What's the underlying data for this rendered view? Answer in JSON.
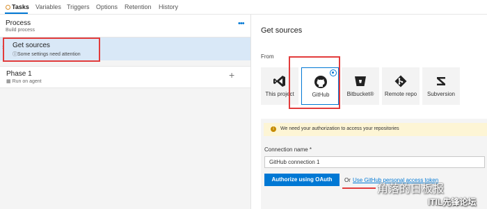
{
  "tabs": [
    {
      "label": "Tasks",
      "active": true
    },
    {
      "label": "Variables"
    },
    {
      "label": "Triggers"
    },
    {
      "label": "Options"
    },
    {
      "label": "Retention"
    },
    {
      "label": "History"
    }
  ],
  "process": {
    "title": "Process",
    "subtitle": "Build process",
    "more": "•••"
  },
  "get_sources_item": {
    "title": "Get sources",
    "warning": "Some settings need attention"
  },
  "phase": {
    "title": "Phase 1",
    "subtitle": "Run on agent",
    "add": "+"
  },
  "right_panel": {
    "title": "Get sources",
    "from_label": "From",
    "sources": [
      {
        "label": "This project",
        "icon": "visual-studio-icon"
      },
      {
        "label": "GitHub",
        "icon": "github-icon",
        "selected": true
      },
      {
        "label": "Bitbucket®",
        "icon": "bitbucket-icon"
      },
      {
        "label": "Remote repo",
        "icon": "git-icon"
      },
      {
        "label": "Subversion",
        "icon": "subversion-icon"
      }
    ]
  },
  "auth": {
    "message": "We need your authorization to access your repositories",
    "connection_label": "Connection name *",
    "connection_value": "GitHub connection 1",
    "oauth_button": "Authorize using OAuth",
    "or": "Or",
    "pat_link": "Use GitHub personal access token"
  },
  "watermark": {
    "line1": "角落的日板报",
    "line2": "ITIL先锋论坛"
  },
  "colors": {
    "accent": "#0078d4",
    "highlight": "#e23b3b",
    "selected_row": "#d9e8f7",
    "warning_bg": "#fdf5d5"
  }
}
